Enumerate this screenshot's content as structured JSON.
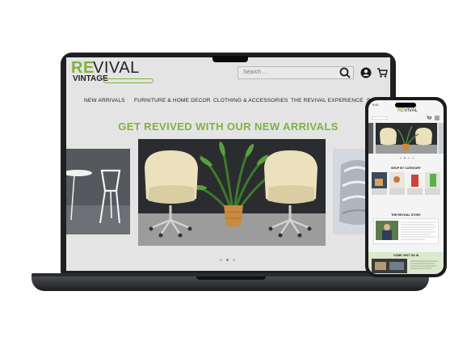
{
  "brand": {
    "name_re": "RE",
    "name_vival": "VIVAL",
    "name_vintage": "VINTAGE",
    "accent": "#7fb241"
  },
  "header": {
    "search_placeholder": "Search ..."
  },
  "nav": {
    "items": [
      {
        "label": "NEW ARRIVALS"
      },
      {
        "label": "FURNITURE & HOME DECOR"
      },
      {
        "label": "CLOTHING & ACCESSORIES"
      },
      {
        "label": "THE REVIVAL EXPERIENCE"
      },
      {
        "label": "S"
      }
    ]
  },
  "hero": {
    "title": "GET REVIVED WITH OUR NEW ARRIVALS",
    "active_slide": 1,
    "slide_count": 3
  },
  "phone": {
    "time": "9:41",
    "shop_title": "SHOP BY CATEGORY",
    "story_title": "THE REVIVAL STORY",
    "visit_title": "COME VISIT US IN"
  }
}
